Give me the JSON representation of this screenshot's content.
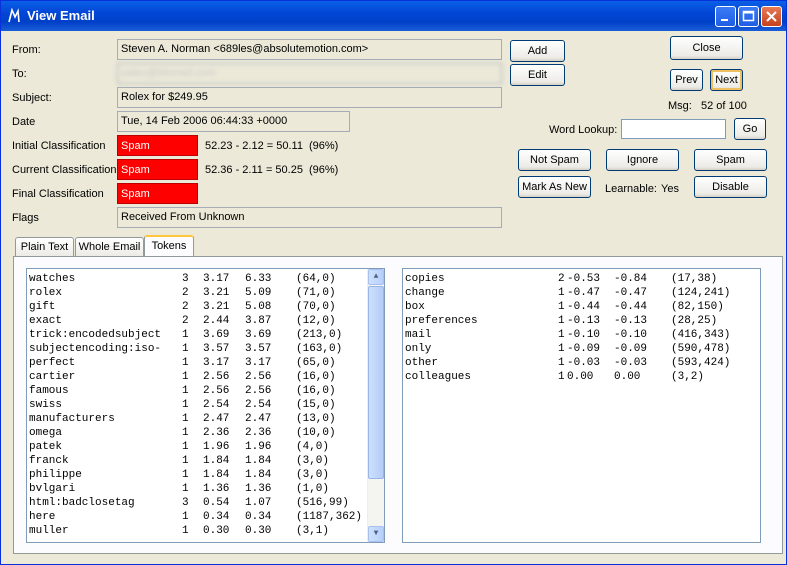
{
  "window": {
    "title": "View Email"
  },
  "fields": {
    "from_label": "From:",
    "from_value": "Steven A. Norman <689les@absolutemotion.com>",
    "to_label": "To:",
    "to_value": "sales@blurred.com",
    "subject_label": "Subject:",
    "subject_value": "Rolex for $249.95",
    "date_label": "Date",
    "date_value": "Tue, 14 Feb 2006 06:44:33 +0000",
    "initial_label": "Initial Classification",
    "initial_value": "Spam",
    "initial_score": "52.23 - 2.12 = 50.11",
    "initial_pct": "(96%)",
    "current_label": "Current Classification",
    "current_value": "Spam",
    "current_score": "52.36 - 2.11 = 50.25",
    "current_pct": "(96%)",
    "final_label": "Final Classification",
    "final_value": "Spam",
    "flags_label": "Flags",
    "flags_value": "Received From Unknown"
  },
  "buttons": {
    "add": "Add",
    "edit": "Edit",
    "close": "Close",
    "prev": "Prev",
    "next": "Next",
    "lookup": "Go",
    "not_spam": "Not Spam",
    "ignore": "Ignore",
    "spam": "Spam",
    "mark_as_new": "Mark As New",
    "disable": "Disable"
  },
  "nav": {
    "msg_label": "Msg:",
    "msg_value": "52 of 100"
  },
  "lookup": {
    "label": "Word Lookup:",
    "value": ""
  },
  "learnable": {
    "label": "Learnable:",
    "value": "Yes"
  },
  "tabs": [
    "Plain Text",
    "Whole Email",
    "Tokens"
  ],
  "active_tab": "Tokens",
  "spam_tokens": [
    [
      "watches",
      "3",
      "3.17",
      "6.33",
      "(64,0)"
    ],
    [
      "rolex",
      "2",
      "3.21",
      "5.09",
      "(71,0)"
    ],
    [
      "gift",
      "2",
      "3.21",
      "5.08",
      "(70,0)"
    ],
    [
      "exact",
      "2",
      "2.44",
      "3.87",
      "(12,0)"
    ],
    [
      "trick:encodedsubject",
      "1",
      "3.69",
      "3.69",
      "(213,0)"
    ],
    [
      "subjectencoding:iso-",
      "1",
      "3.57",
      "3.57",
      "(163,0)"
    ],
    [
      "perfect",
      "1",
      "3.17",
      "3.17",
      "(65,0)"
    ],
    [
      "cartier",
      "1",
      "2.56",
      "2.56",
      "(16,0)"
    ],
    [
      "famous",
      "1",
      "2.56",
      "2.56",
      "(16,0)"
    ],
    [
      "swiss",
      "1",
      "2.54",
      "2.54",
      "(15,0)"
    ],
    [
      "manufacturers",
      "1",
      "2.47",
      "2.47",
      "(13,0)"
    ],
    [
      "omega",
      "1",
      "2.36",
      "2.36",
      "(10,0)"
    ],
    [
      "patek",
      "1",
      "1.96",
      "1.96",
      "(4,0)"
    ],
    [
      "franck",
      "1",
      "1.84",
      "1.84",
      "(3,0)"
    ],
    [
      "philippe",
      "1",
      "1.84",
      "1.84",
      "(3,0)"
    ],
    [
      "bvlgari",
      "1",
      "1.36",
      "1.36",
      "(1,0)"
    ],
    [
      "html:badclosetag",
      "3",
      "0.54",
      "1.07",
      "(516,99)"
    ],
    [
      "here",
      "1",
      "0.34",
      "0.34",
      "(1187,362)"
    ],
    [
      "muller",
      "1",
      "0.30",
      "0.30",
      "(3,1)"
    ]
  ],
  "ham_tokens": [
    [
      "copies",
      "2",
      "-0.53",
      "-0.84",
      "(17,38)"
    ],
    [
      "change",
      "1",
      "-0.47",
      "-0.47",
      "(124,241)"
    ],
    [
      "box",
      "1",
      "-0.44",
      "-0.44",
      "(82,150)"
    ],
    [
      "preferences",
      "1",
      "-0.13",
      "-0.13",
      "(28,25)"
    ],
    [
      "mail",
      "1",
      "-0.10",
      "-0.10",
      "(416,343)"
    ],
    [
      "only",
      "1",
      "-0.09",
      "-0.09",
      "(590,478)"
    ],
    [
      "other",
      "1",
      "-0.03",
      "-0.03",
      "(593,424)"
    ],
    [
      "colleagues",
      "1",
      "0.00",
      "0.00",
      "(3,2)"
    ]
  ],
  "colors": {
    "spam": "#ff0000",
    "titlebar": "#0346d6"
  }
}
